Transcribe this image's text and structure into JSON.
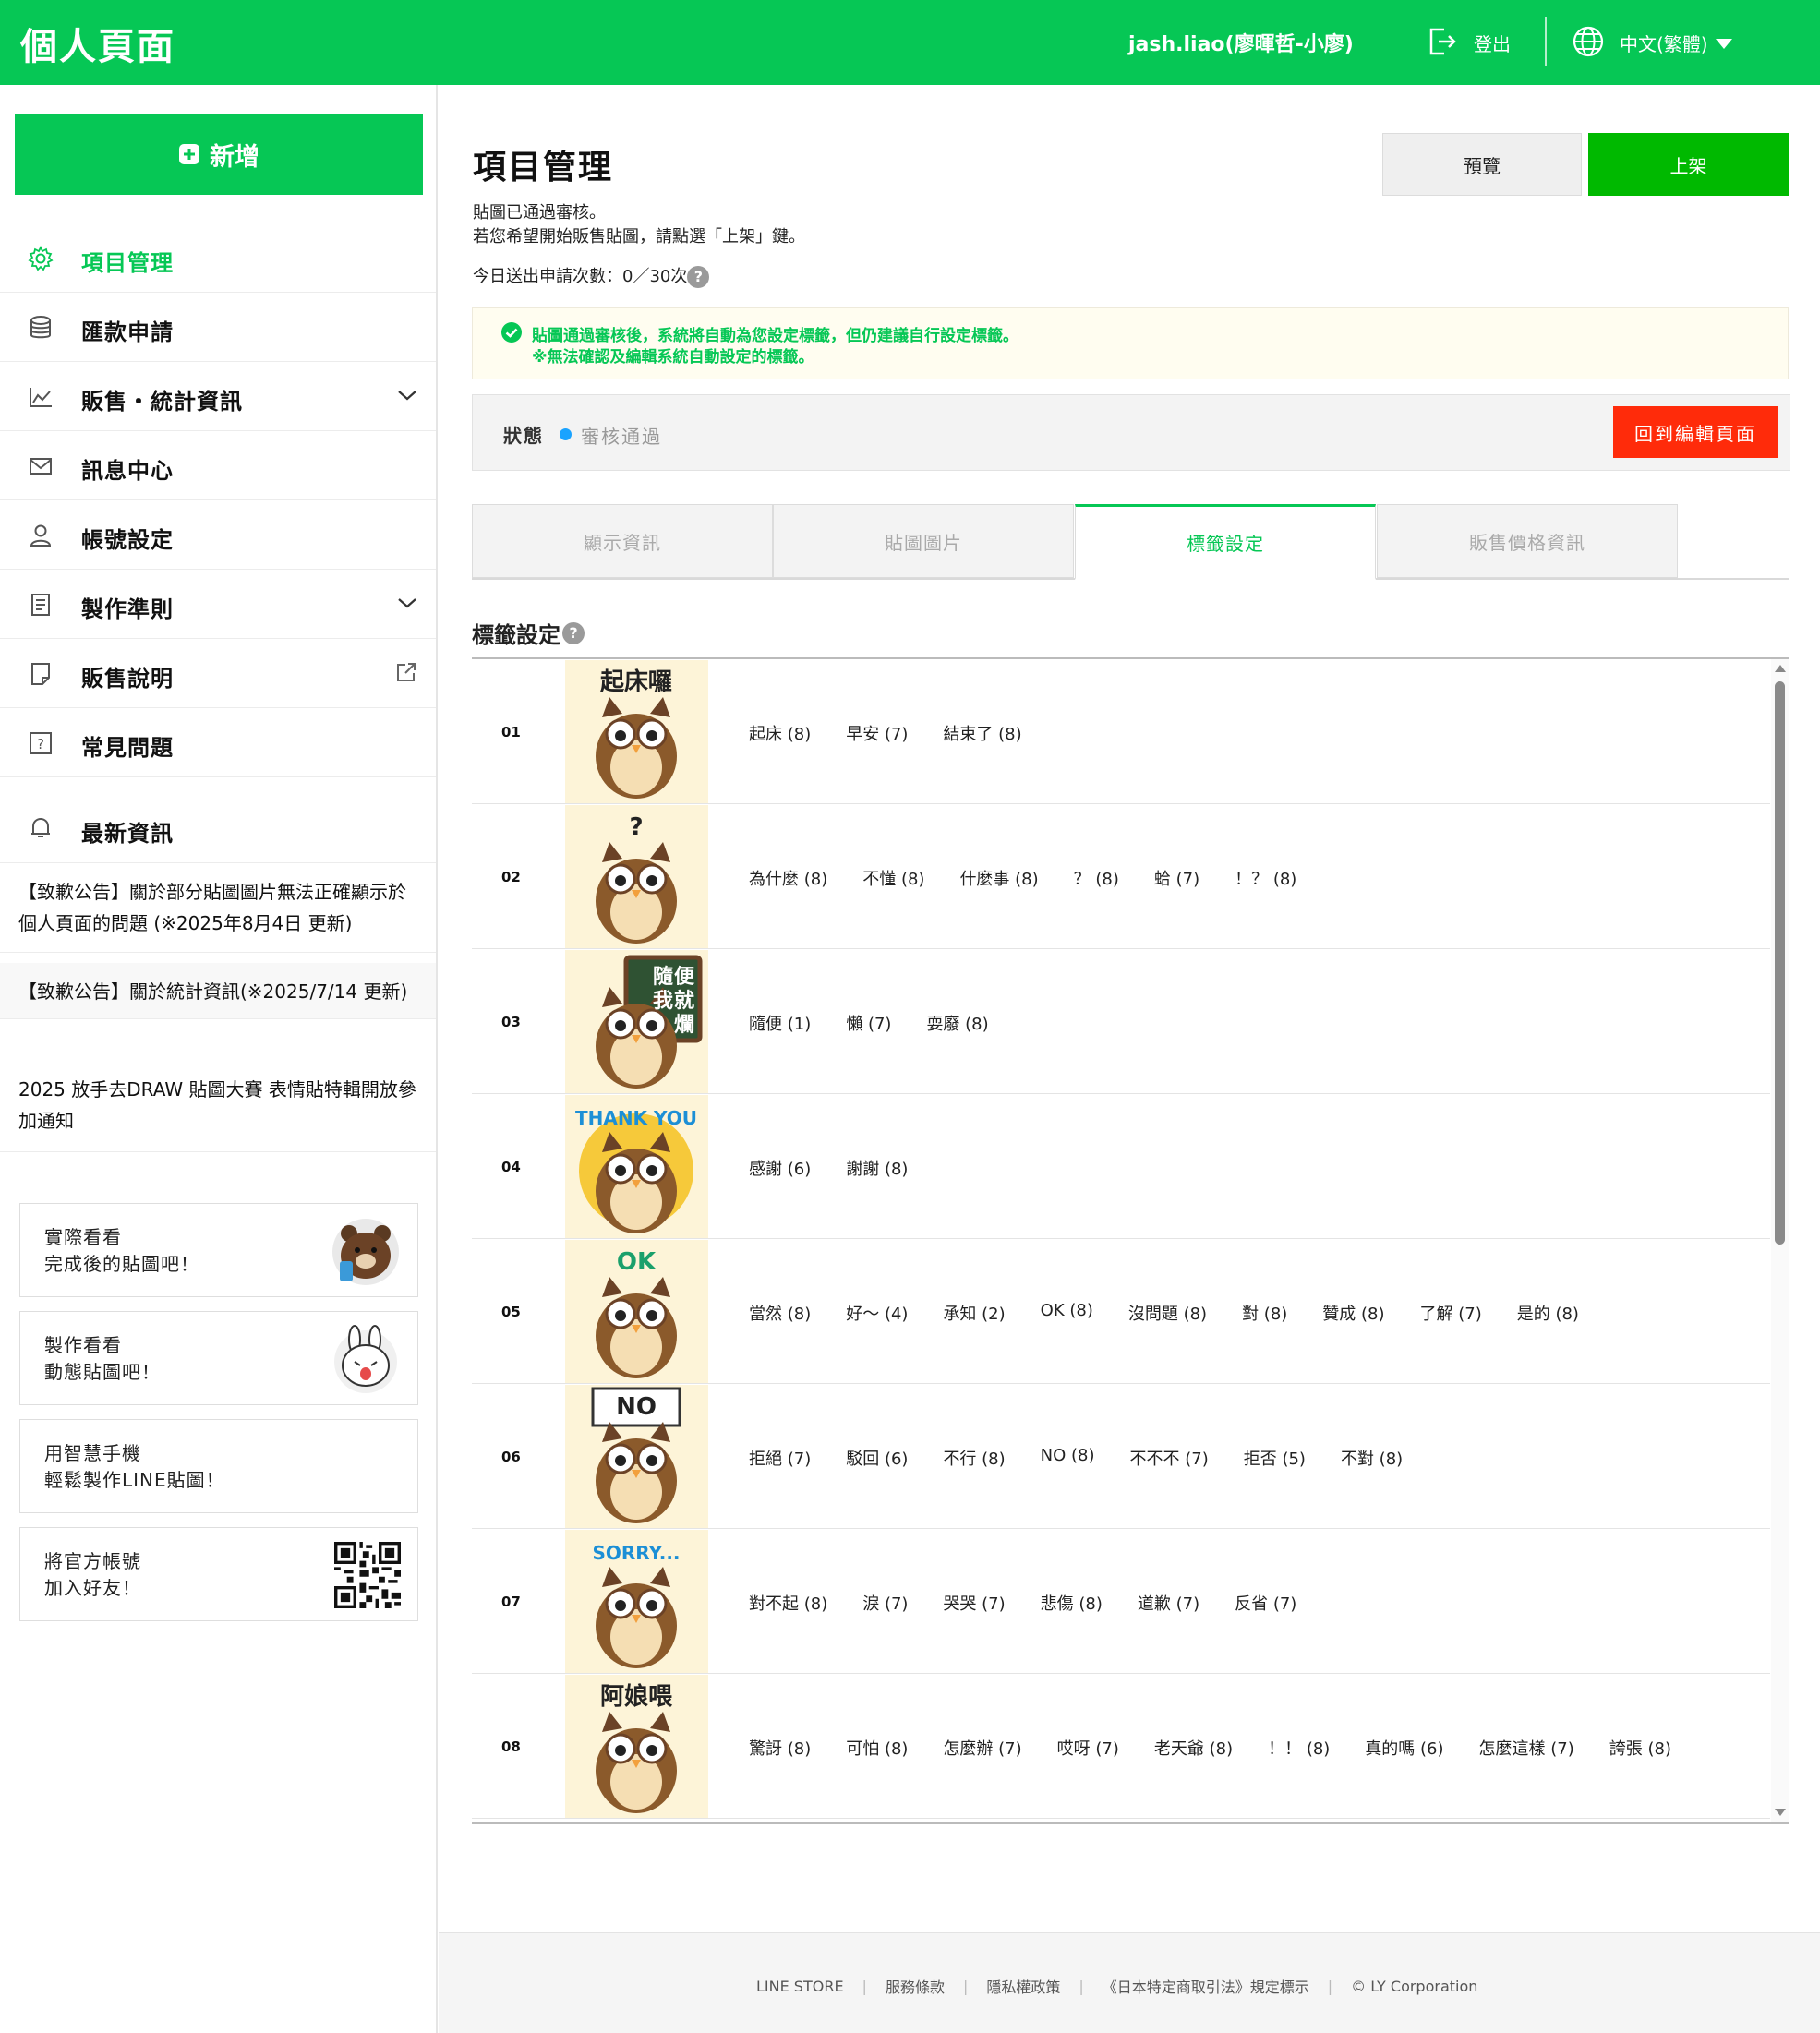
{
  "header": {
    "brand": "個人頁面",
    "user": "jash.liao(廖暉哲-小廖)",
    "logout": "登出",
    "language": "中文(繁體)"
  },
  "sidebar": {
    "add_button": "新增",
    "nav": [
      {
        "label": "項目管理",
        "icon": "gear-icon",
        "active": true
      },
      {
        "label": "匯款申請",
        "icon": "database-icon"
      },
      {
        "label": "販售・統計資訊",
        "icon": "chart-icon",
        "expandable": true
      },
      {
        "label": "訊息中心",
        "icon": "mail-icon"
      },
      {
        "label": "帳號設定",
        "icon": "user-icon"
      },
      {
        "label": "製作準則",
        "icon": "document-icon",
        "expandable": true
      },
      {
        "label": "販售說明",
        "icon": "note-icon",
        "external": true
      },
      {
        "label": "常見問題",
        "icon": "question-icon"
      },
      {
        "label": "最新資訊",
        "icon": "bell-icon"
      }
    ],
    "news": [
      "【致歉公告】關於部分貼圖圖片無法正確顯示於個人頁面的問題 (※2025年8月4日 更新)",
      "【致歉公告】關於統計資訊(※2025/7/14 更新)",
      "2025 放手去DRAW 貼圖大賽 表情貼特輯開放參加通知"
    ],
    "promos": [
      {
        "line1": "實際看看",
        "line2": "完成後的貼圖吧！"
      },
      {
        "line1": "製作看看",
        "line2": "動態貼圖吧！"
      },
      {
        "line1": "用智慧手機",
        "line2": "輕鬆製作LINE貼圖！"
      },
      {
        "line1": "將官方帳號",
        "line2": "加入好友！"
      }
    ]
  },
  "main": {
    "title": "項目管理",
    "preview_button": "預覽",
    "publish_button": "上架",
    "message_line1": "貼圖已通過審核。",
    "message_line2": "若您希望開始販售貼圖，請點選「上架」鍵。",
    "request_count": "今日送出申請次數：0／30次",
    "notice_line1": "貼圖通過審核後，系統將自動為您設定標籤，但仍建議自行設定標籤。",
    "notice_line2": "※無法確認及編輯系統自動設定的標籤。",
    "status_label": "狀態",
    "status_value": "審核通過",
    "back_button": "回到編輯頁面",
    "tabs": [
      "顯示資訊",
      "貼圖圖片",
      "標籤設定",
      "販售價格資訊"
    ],
    "active_tab": 2,
    "section_title": "標籤設定",
    "stickers": [
      {
        "num": "01",
        "caption": "起床囉",
        "tags": [
          "起床 (8)",
          "早安 (7)",
          "結束了 (8)"
        ]
      },
      {
        "num": "02",
        "caption": "?",
        "tags": [
          "為什麼 (8)",
          "不懂 (8)",
          "什麼事 (8)",
          "？ (8)",
          "蛤 (7)",
          "！？ (8)"
        ]
      },
      {
        "num": "03",
        "caption": "隨便我就爛",
        "tags": [
          "隨便 (1)",
          "懶 (7)",
          "耍廢 (8)"
        ]
      },
      {
        "num": "04",
        "caption": "THANK YOU",
        "tags": [
          "感謝 (6)",
          "謝謝 (8)"
        ]
      },
      {
        "num": "05",
        "caption": "OK",
        "tags": [
          "當然 (8)",
          "好～ (4)",
          "承知 (2)",
          "OK (8)",
          "沒問題 (8)",
          "對 (8)",
          "贊成 (8)",
          "了解 (7)",
          "是的 (8)"
        ]
      },
      {
        "num": "06",
        "caption": "NO",
        "tags": [
          "拒絕 (7)",
          "駁回 (6)",
          "不行 (8)",
          "NO (8)",
          "不不不 (7)",
          "拒否 (5)",
          "不對 (8)"
        ]
      },
      {
        "num": "07",
        "caption": "SORRY...",
        "tags": [
          "對不起 (8)",
          "淚 (7)",
          "哭哭 (7)",
          "悲傷 (8)",
          "道歉 (7)",
          "反省 (7)"
        ]
      },
      {
        "num": "08",
        "caption": "阿娘喂",
        "tags": [
          "驚訝 (8)",
          "可怕 (8)",
          "怎麼辦 (7)",
          "哎呀 (7)",
          "老天爺 (8)",
          "！！ (8)",
          "真的嗎 (6)",
          "怎麼這樣 (7)",
          "誇張 (8)"
        ]
      }
    ]
  },
  "footer": {
    "links": [
      "LINE STORE",
      "服務條款",
      "隱私權政策",
      "《日本特定商取引法》規定標示",
      "© LY Corporation"
    ]
  },
  "colors": {
    "brand_green": "#06c755",
    "publish_green": "#00b900",
    "back_red": "#ff2b0a",
    "status_blue": "#1aa3ff"
  }
}
